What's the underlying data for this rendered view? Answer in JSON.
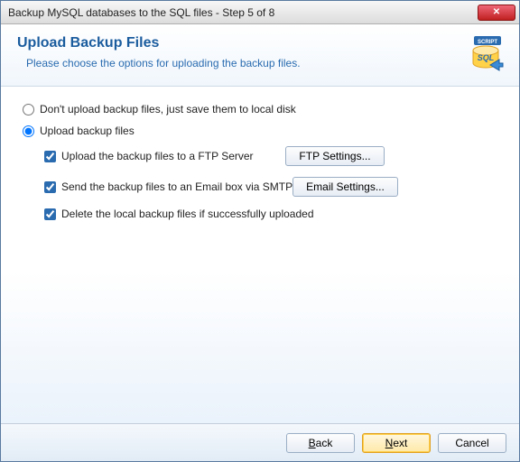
{
  "window": {
    "title": "Backup MySQL databases to the SQL files - Step 5 of 8"
  },
  "header": {
    "title": "Upload Backup Files",
    "subtitle": "Please choose the options for uploading the backup files.",
    "icon_badge": "SCRIPT",
    "icon_label": "SQL"
  },
  "options": {
    "radio_no_upload": "Don't upload backup files, just save them to local disk",
    "radio_upload": "Upload backup files",
    "selected_radio": "upload",
    "ftp_checkbox": "Upload the backup files to a FTP Server",
    "ftp_checked": true,
    "ftp_button": "FTP Settings...",
    "email_checkbox": "Send the backup files to an Email box via SMTP",
    "email_checked": true,
    "email_button": "Email Settings...",
    "delete_checkbox": "Delete the local backup files if successfully uploaded",
    "delete_checked": true
  },
  "footer": {
    "back_u": "B",
    "back_rest": "ack",
    "next_u": "N",
    "next_rest": "ext",
    "cancel": "Cancel"
  }
}
